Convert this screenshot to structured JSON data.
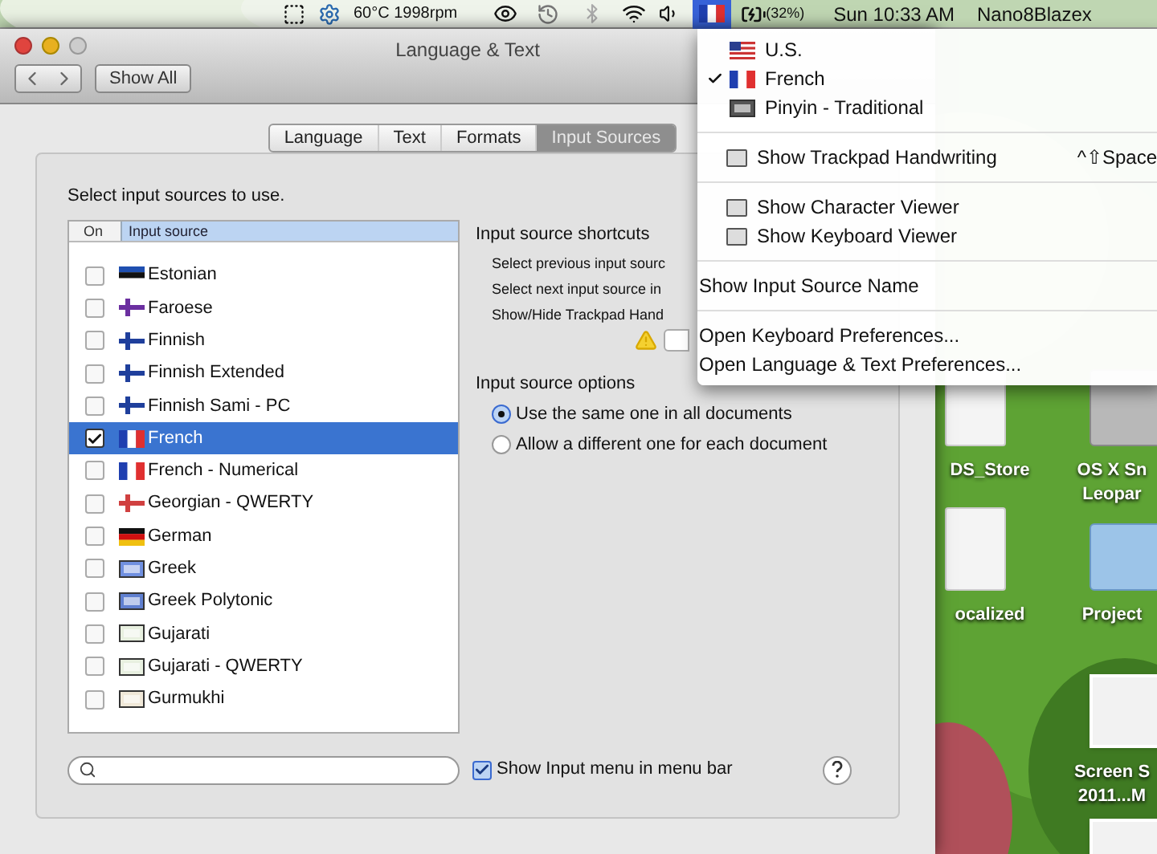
{
  "menubar": {
    "sensors": "60°C 1998rpm",
    "battery": "(32%)",
    "clock": "Sun 10:33 AM",
    "user": "Nano8Blazex"
  },
  "window": {
    "title": "Language & Text",
    "show_all": "Show All"
  },
  "tabs": [
    {
      "label": "Language",
      "selected": false
    },
    {
      "label": "Text",
      "selected": false
    },
    {
      "label": "Formats",
      "selected": false
    },
    {
      "label": "Input Sources",
      "selected": true
    }
  ],
  "instruction": "Select input sources to use.",
  "source_list": {
    "columns": [
      "On",
      "Input source"
    ],
    "rows": [
      {
        "label": "Estonian",
        "checked": false,
        "selected": false
      },
      {
        "label": "Faroese",
        "checked": false,
        "selected": false
      },
      {
        "label": "Finnish",
        "checked": false,
        "selected": false
      },
      {
        "label": "Finnish Extended",
        "checked": false,
        "selected": false
      },
      {
        "label": "Finnish Sami - PC",
        "checked": false,
        "selected": false
      },
      {
        "label": "French",
        "checked": true,
        "selected": true
      },
      {
        "label": "French - Numerical",
        "checked": false,
        "selected": false
      },
      {
        "label": "Georgian - QWERTY",
        "checked": false,
        "selected": false
      },
      {
        "label": "German",
        "checked": false,
        "selected": false
      },
      {
        "label": "Greek",
        "checked": false,
        "selected": false
      },
      {
        "label": "Greek Polytonic",
        "checked": false,
        "selected": false
      },
      {
        "label": "Gujarati",
        "checked": false,
        "selected": false
      },
      {
        "label": "Gujarati - QWERTY",
        "checked": false,
        "selected": false
      },
      {
        "label": "Gurmukhi",
        "checked": false,
        "selected": false
      }
    ]
  },
  "shortcuts": {
    "title": "Input source shortcuts",
    "lines": [
      "Select previous input sourc",
      "Select next input source in",
      "Show/Hide Trackpad Hand"
    ]
  },
  "options": {
    "title": "Input source options",
    "radios": [
      {
        "label": "Use the same one in all documents",
        "selected": true
      },
      {
        "label": "Allow a different one for each document",
        "selected": false
      }
    ]
  },
  "show_menu": {
    "label": "Show Input menu in menu bar",
    "checked": true
  },
  "input_menu": [
    {
      "kind": "source",
      "label": "U.S.",
      "checked": false
    },
    {
      "kind": "source",
      "label": "French",
      "checked": true
    },
    {
      "kind": "source",
      "label": "Pinyin - Traditional",
      "checked": false
    },
    {
      "kind": "separator"
    },
    {
      "kind": "command",
      "label": "Show Trackpad Handwriting",
      "shortcut": "^⇧Space"
    },
    {
      "kind": "separator"
    },
    {
      "kind": "command",
      "label": "Show Character Viewer"
    },
    {
      "kind": "command",
      "label": "Show Keyboard Viewer"
    },
    {
      "kind": "separator"
    },
    {
      "kind": "command",
      "label": "Show Input Source Name"
    },
    {
      "kind": "separator"
    },
    {
      "kind": "command",
      "label": "Open Keyboard Preferences..."
    },
    {
      "kind": "command",
      "label": "Open Language & Text Preferences..."
    }
  ],
  "desktop_icons": [
    {
      "kind": "file",
      "lines": [
        "DS_Store"
      ]
    },
    {
      "kind": "drive",
      "lines": [
        "OS X Sn",
        "Leopar"
      ]
    },
    {
      "kind": "file",
      "lines": [
        "ocalized"
      ]
    },
    {
      "kind": "folder",
      "lines": [
        "Project"
      ]
    },
    {
      "kind": "screenshot",
      "lines": [
        "Screen S",
        "2011...M"
      ]
    },
    {
      "kind": "screenshot"
    }
  ]
}
